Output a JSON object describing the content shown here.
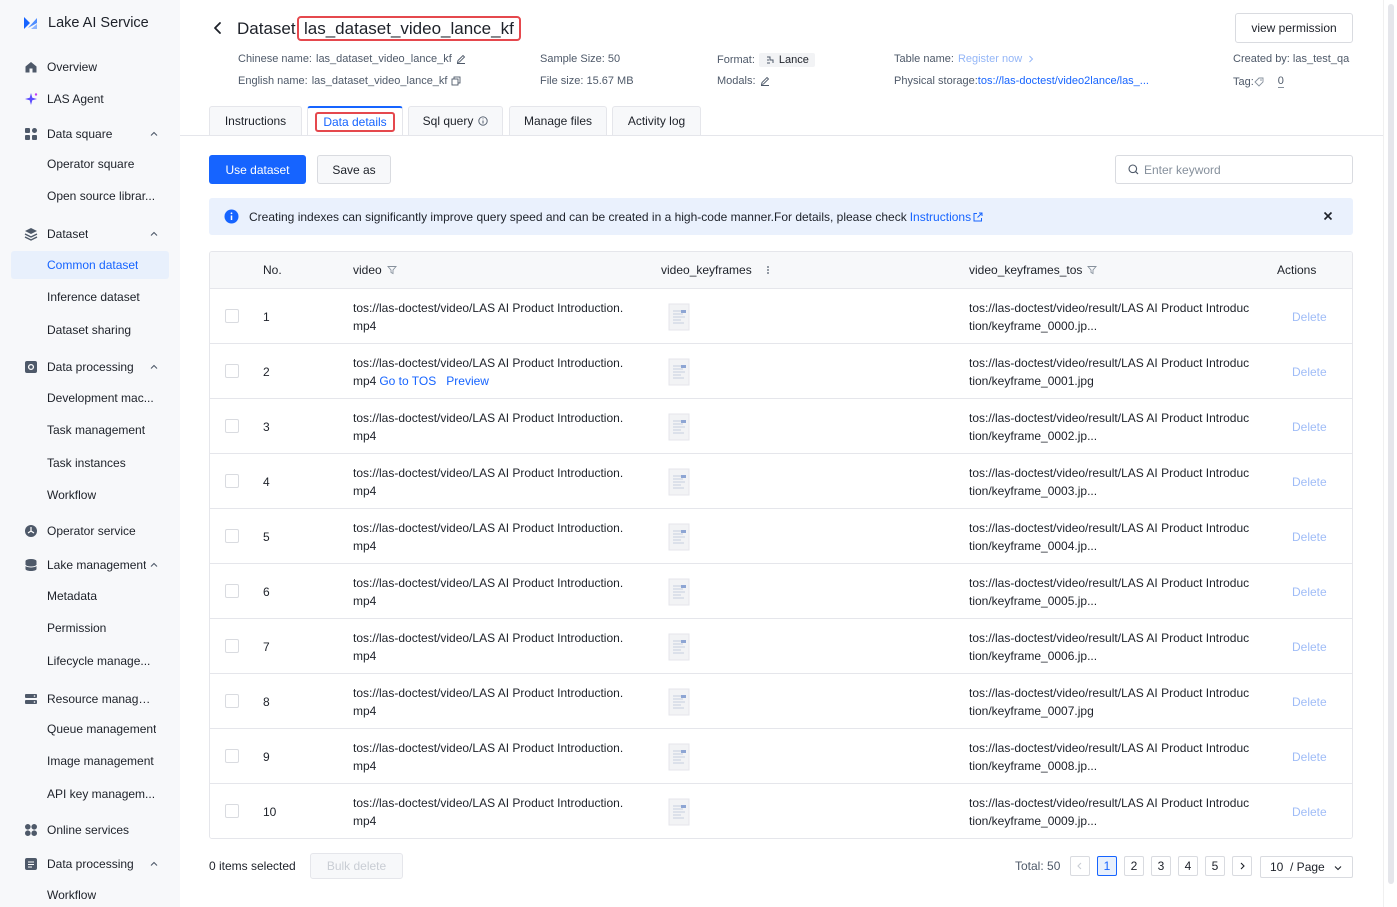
{
  "app": {
    "title": "Lake AI Service"
  },
  "sidebar": {
    "items": [
      {
        "label": "Overview",
        "kind": "group",
        "icon": "overview-icon"
      },
      {
        "label": "LAS Agent",
        "kind": "group",
        "icon": "sparkle-icon"
      },
      {
        "label": "Data square",
        "kind": "group",
        "icon": "grid-icon",
        "expanded": true
      },
      {
        "label": "Operator square",
        "kind": "sub"
      },
      {
        "label": "Open source librar...",
        "kind": "sub"
      },
      {
        "label": "Dataset",
        "kind": "group",
        "icon": "dataset-icon",
        "expanded": true
      },
      {
        "label": "Common dataset",
        "kind": "sub",
        "active": true
      },
      {
        "label": "Inference dataset",
        "kind": "sub"
      },
      {
        "label": "Dataset sharing",
        "kind": "sub"
      },
      {
        "label": "Data processing",
        "kind": "group",
        "icon": "processing-icon",
        "expanded": true
      },
      {
        "label": "Development mac...",
        "kind": "sub"
      },
      {
        "label": "Task management",
        "kind": "sub"
      },
      {
        "label": "Task instances",
        "kind": "sub"
      },
      {
        "label": "Workflow",
        "kind": "sub"
      },
      {
        "label": "Operator service",
        "kind": "group",
        "icon": "operator-icon"
      },
      {
        "label": "Lake management",
        "kind": "group",
        "icon": "database-icon",
        "expanded": true
      },
      {
        "label": "Metadata",
        "kind": "sub"
      },
      {
        "label": "Permission",
        "kind": "sub"
      },
      {
        "label": "Lifecycle manage...",
        "kind": "sub"
      },
      {
        "label": "Resource managemen",
        "kind": "group",
        "icon": "server-icon"
      },
      {
        "label": "Queue management",
        "kind": "sub"
      },
      {
        "label": "Image management",
        "kind": "sub"
      },
      {
        "label": "API key managem...",
        "kind": "sub"
      },
      {
        "label": "Online services",
        "kind": "group",
        "icon": "services-icon"
      },
      {
        "label": "Data processing",
        "kind": "group",
        "icon": "processing2-icon",
        "expanded": true
      },
      {
        "label": "Workflow",
        "kind": "sub"
      }
    ]
  },
  "header": {
    "title_prefix": "Dataset",
    "dataset_name": "las_dataset_video_lance_kf",
    "view_permission": "view permission"
  },
  "meta": {
    "chinese_name_label": "Chinese name:",
    "chinese_name": "las_dataset_video_lance_kf",
    "english_name_label": "English name:",
    "english_name": "las_dataset_video_lance_kf",
    "sample_size": "Sample Size: 50",
    "file_size": "File size: 15.67 MB",
    "format_label": "Format:",
    "format_value": "Lance",
    "modals_label": "Modals:",
    "table_name_label": "Table name:",
    "table_name_link": "Register now",
    "physical_storage_label": "Physical storage:",
    "physical_storage": "tos://las-doctest/video2lance/las_...",
    "created_by": "Created by: las_test_qa",
    "tag_label": "Tag:",
    "tag_value": "0"
  },
  "tabs": [
    "Instructions",
    "Data details",
    "Sql query",
    "Manage files",
    "Activity log"
  ],
  "toolbar": {
    "use_dataset": "Use dataset",
    "save_as": "Save as",
    "search_placeholder": "Enter keyword"
  },
  "alert": {
    "text": "Creating indexes can significantly improve query speed and can be created in a high-code manner.For details, please check",
    "link": "Instructions"
  },
  "table": {
    "headers": [
      "No.",
      "video",
      "video_keyframes",
      "video_keyframes_tos",
      "Actions"
    ],
    "rows": [
      {
        "no": "1",
        "video": "tos://las-doctest/video/LAS AI Product Introduction.mp4",
        "tos": "tos://las-doctest/video/result/LAS AI Product Introduction/keyframe_0000.jp...",
        "action": "Delete"
      },
      {
        "no": "2",
        "video": "tos://las-doctest/video/LAS AI Product Introduction.mp4",
        "tos": "tos://las-doctest/video/result/LAS AI Product Introduction/keyframe_0001.jpg",
        "action": "Delete",
        "go_tos": "Go to TOS",
        "preview": "Preview"
      },
      {
        "no": "3",
        "video": "tos://las-doctest/video/LAS AI Product Introduction.mp4",
        "tos": "tos://las-doctest/video/result/LAS AI Product Introduction/keyframe_0002.jp...",
        "action": "Delete"
      },
      {
        "no": "4",
        "video": "tos://las-doctest/video/LAS AI Product Introduction.mp4",
        "tos": "tos://las-doctest/video/result/LAS AI Product Introduction/keyframe_0003.jp...",
        "action": "Delete"
      },
      {
        "no": "5",
        "video": "tos://las-doctest/video/LAS AI Product Introduction.mp4",
        "tos": "tos://las-doctest/video/result/LAS AI Product Introduction/keyframe_0004.jp...",
        "action": "Delete"
      },
      {
        "no": "6",
        "video": "tos://las-doctest/video/LAS AI Product Introduction.mp4",
        "tos": "tos://las-doctest/video/result/LAS AI Product Introduction/keyframe_0005.jp...",
        "action": "Delete"
      },
      {
        "no": "7",
        "video": "tos://las-doctest/video/LAS AI Product Introduction.mp4",
        "tos": "tos://las-doctest/video/result/LAS AI Product Introduction/keyframe_0006.jp...",
        "action": "Delete"
      },
      {
        "no": "8",
        "video": "tos://las-doctest/video/LAS AI Product Introduction.mp4",
        "tos": "tos://las-doctest/video/result/LAS AI Product Introduction/keyframe_0007.jpg",
        "action": "Delete"
      },
      {
        "no": "9",
        "video": "tos://las-doctest/video/LAS AI Product Introduction.mp4",
        "tos": "tos://las-doctest/video/result/LAS AI Product Introduction/keyframe_0008.jp...",
        "action": "Delete"
      },
      {
        "no": "10",
        "video": "tos://las-doctest/video/LAS AI Product Introduction.mp4",
        "tos": "tos://las-doctest/video/result/LAS AI Product Introduction/keyframe_0009.jp...",
        "action": "Delete"
      }
    ]
  },
  "footer": {
    "selected": "0 items selected",
    "bulk_delete": "Bulk delete",
    "total": "Total: 50",
    "pages": [
      "1",
      "2",
      "3",
      "4",
      "5"
    ],
    "current_page": "1",
    "page_size": "10  / Page"
  },
  "colors": {
    "accent": "#1664ff",
    "highlight": "#e5484d",
    "sidebar_bg": "#f7f8fa"
  }
}
